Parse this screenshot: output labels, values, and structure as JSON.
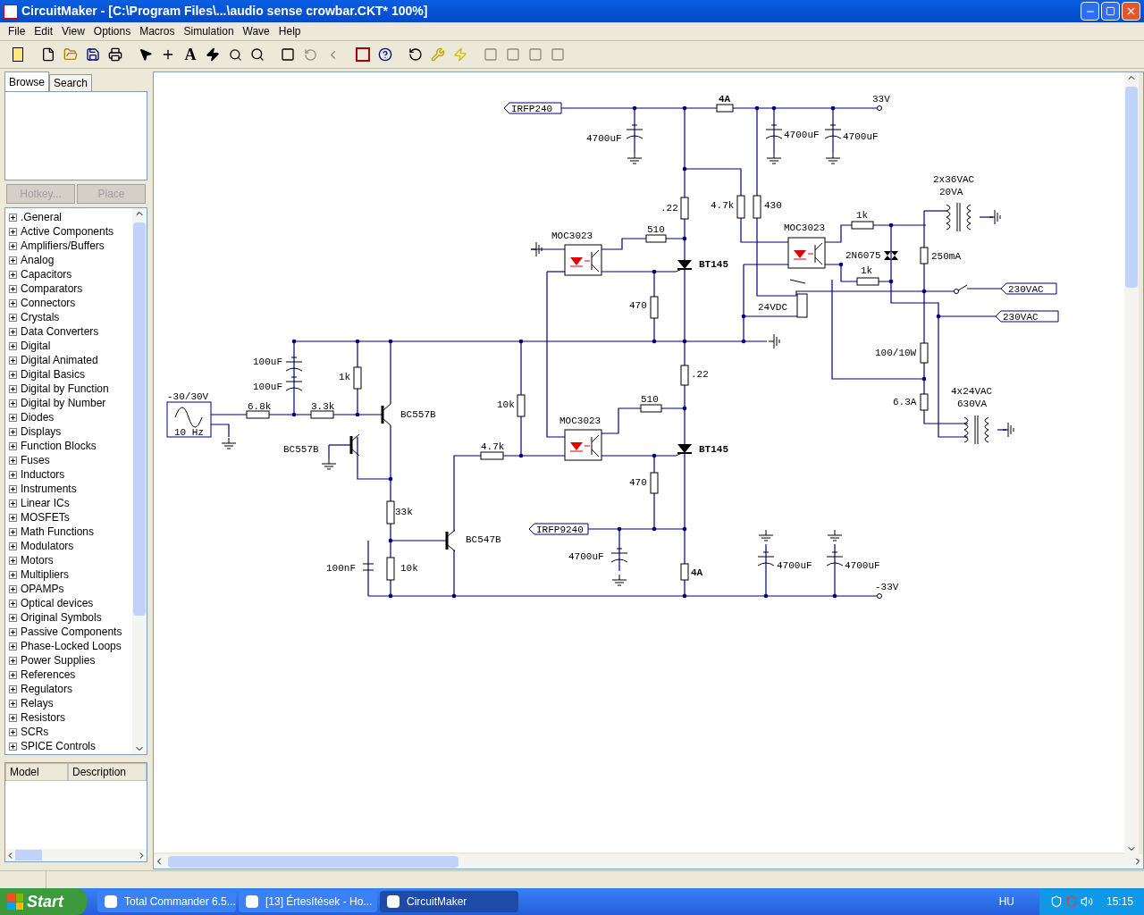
{
  "window": {
    "title": "CircuitMaker - [C:\\Program Files\\...\\audio sense crowbar.CKT* 100%]"
  },
  "toolbar": {
    "text_tool": "A"
  },
  "menu": [
    "File",
    "Edit",
    "View",
    "Options",
    "Macros",
    "Simulation",
    "Wave",
    "Help"
  ],
  "sidebar": {
    "tabs": [
      {
        "label": "Browse",
        "selected": true
      },
      {
        "label": "Search",
        "selected": false
      }
    ],
    "buttons": [
      {
        "label": "Hotkey...",
        "disabled": true
      },
      {
        "label": "Place",
        "disabled": true
      }
    ],
    "tree": [
      {
        "label": ".General",
        "expanded": false
      },
      {
        "label": "Active Components",
        "expanded": false
      },
      {
        "label": "Amplifiers/Buffers",
        "expanded": false
      },
      {
        "label": "Analog",
        "expanded": false
      },
      {
        "label": "Capacitors",
        "expanded": false
      },
      {
        "label": "Comparators",
        "expanded": false
      },
      {
        "label": "Connectors",
        "expanded": false
      },
      {
        "label": "Crystals",
        "expanded": false
      },
      {
        "label": "Data Converters",
        "expanded": false
      },
      {
        "label": "Digital",
        "expanded": false
      },
      {
        "label": "Digital Animated",
        "expanded": false
      },
      {
        "label": "Digital Basics",
        "expanded": false
      },
      {
        "label": "Digital by Function",
        "expanded": false
      },
      {
        "label": "Digital by Number",
        "expanded": false
      },
      {
        "label": "Diodes",
        "expanded": false
      },
      {
        "label": "Displays",
        "expanded": false
      },
      {
        "label": "Function Blocks",
        "expanded": false
      },
      {
        "label": "Fuses",
        "expanded": false
      },
      {
        "label": "Inductors",
        "expanded": false
      },
      {
        "label": "Instruments",
        "expanded": false
      },
      {
        "label": "Linear ICs",
        "expanded": false
      },
      {
        "label": "MOSFETs",
        "expanded": false
      },
      {
        "label": "Math Functions",
        "expanded": false
      },
      {
        "label": "Modulators",
        "expanded": false
      },
      {
        "label": "Motors",
        "expanded": false
      },
      {
        "label": "Multipliers",
        "expanded": false
      },
      {
        "label": "OPAMPs",
        "expanded": false
      },
      {
        "label": "Optical devices",
        "expanded": false
      },
      {
        "label": "Original Symbols",
        "expanded": false
      },
      {
        "label": "Passive Components",
        "expanded": false
      },
      {
        "label": "Phase-Locked Loops",
        "expanded": false
      },
      {
        "label": "Power Supplies",
        "expanded": false
      },
      {
        "label": "References",
        "expanded": false
      },
      {
        "label": "Regulators",
        "expanded": false
      },
      {
        "label": "Relays",
        "expanded": false
      },
      {
        "label": "Resistors",
        "expanded": false
      },
      {
        "label": "SCRs",
        "expanded": false
      },
      {
        "label": "SPICE Controls",
        "expanded": false
      }
    ],
    "table": {
      "columns": [
        "Model",
        "Description"
      ]
    }
  },
  "schematic": {
    "labels": [
      "4A",
      "33V",
      "4700uF",
      "4700uF",
      "4700uF",
      ".22",
      "4.7k",
      "430",
      "2x36VAC",
      "20VA",
      "MOC3023",
      "510",
      "MOC3023",
      "1k",
      "BT145",
      "2N6075",
      "250mA",
      "1k",
      "470",
      "24VDC",
      "100/10W",
      "100uF",
      "1k",
      ".22",
      "100uF",
      "-30/30V",
      "10k",
      "510",
      "6.8k",
      "3.3k",
      "BC557B",
      "6.3A",
      "4x24VAC",
      "630VA",
      "MOC3023",
      "10 Hz",
      "BC557B",
      "4.7k",
      "BT145",
      "470",
      "33k",
      "BC547B",
      "4700uF",
      "4A",
      "4700uF",
      "4700uF",
      "100nF",
      "10k",
      "-33V"
    ],
    "net_labels": [
      "IRFP240",
      "230VAC",
      "230VAC",
      "IRFP9240"
    ]
  },
  "taskbar": {
    "start": "Start",
    "tasks": [
      {
        "label": "Total Commander 6.5...",
        "selected": false
      },
      {
        "label": "[13] Értesítések - Ho...",
        "selected": false
      },
      {
        "label": "CircuitMaker",
        "selected": true
      }
    ],
    "language": "HU",
    "clock": "15:15"
  }
}
